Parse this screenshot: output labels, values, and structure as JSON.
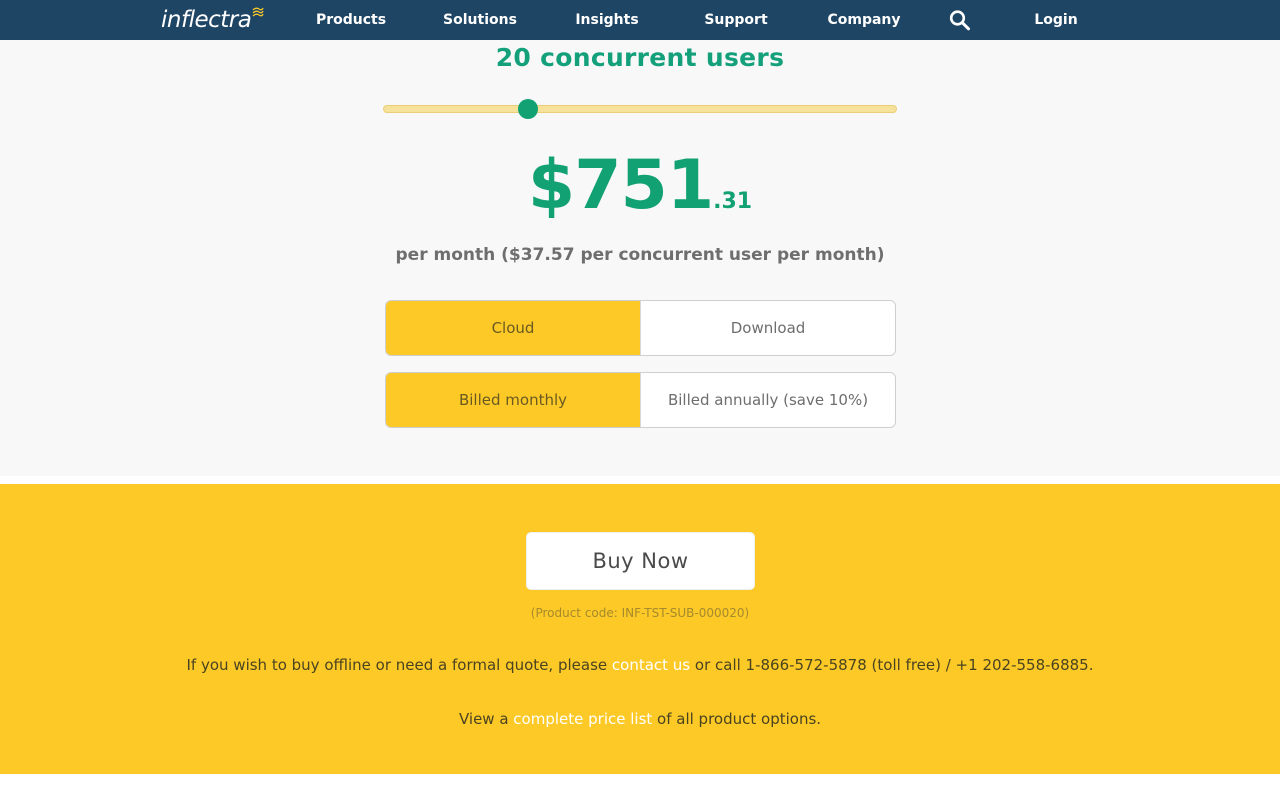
{
  "nav": {
    "logo_text": "inflectra",
    "items": [
      "Products",
      "Solutions",
      "Insights",
      "Support",
      "Company"
    ],
    "login_label": "Login",
    "search_icon": "search-icon"
  },
  "pricing": {
    "users_heading": "20 concurrent users",
    "slider_value": 20,
    "price_whole": "$751",
    "price_cents": ".31",
    "per_month_text": "per month ($37.57 per concurrent user per month)",
    "deployment": {
      "options": [
        "Cloud",
        "Download"
      ],
      "selected": "Cloud"
    },
    "billing": {
      "options": [
        "Billed monthly",
        "Billed annually (save 10%)"
      ],
      "selected": "Billed monthly"
    }
  },
  "buy": {
    "button_label": "Buy Now",
    "product_code": "(Product code: INF-TST-SUB-000020)",
    "offline_prefix": "If you wish to buy offline or need a formal quote, please ",
    "contact_link": "contact us",
    "offline_suffix": " or call 1-866-572-5878 (toll free) / +1 202-558-6885.",
    "pricelist_prefix": "View a ",
    "pricelist_link": "complete price list",
    "pricelist_suffix": " of all product options."
  },
  "colors": {
    "nav_bg": "#1f4565",
    "accent_green": "#12a173",
    "brand_yellow": "#fcc927",
    "slider_track": "#f7e29c"
  }
}
